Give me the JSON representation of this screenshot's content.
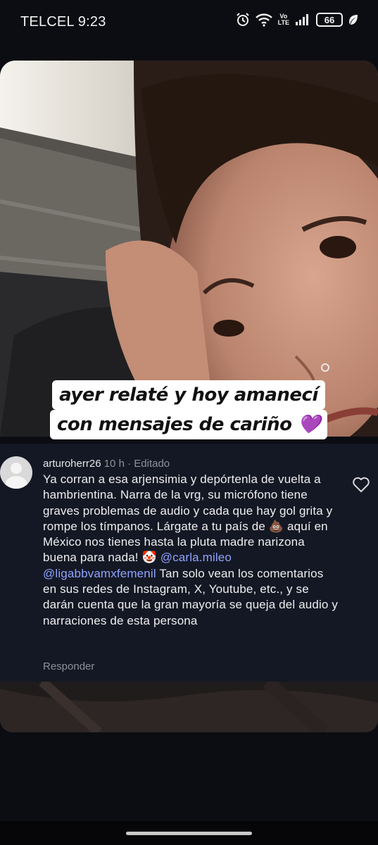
{
  "status_bar": {
    "carrier_time": "TELCEL 9:23",
    "volte_top": "Vo",
    "volte_bottom": "LTE",
    "battery": "66",
    "icons": [
      "alarm-icon",
      "wifi-icon",
      "volte-icon",
      "signal-icon",
      "battery-icon",
      "leaf-icon"
    ]
  },
  "story": {
    "caption_line1": "ayer relaté y hoy amanecí",
    "caption_line2": "con mensajes de cariño 💜"
  },
  "comment": {
    "username": "arturoherr26",
    "time": "10 h",
    "separator": " · ",
    "edited": "Editado",
    "text_part1": "Ya corran a esa arjensimia y depórtenla de vuelta a hambrientina. Narra de la vrg, su micrófono tiene graves problemas de audio y cada que hay gol grita y rompe los tímpanos. Lárgate a tu país de 💩 aquí en México nos tienes hasta la pluta madre narizona buena para nada! 🤡 ",
    "mention1": "@carla.mileo",
    "mention2": "@ligabbvamxfemenil",
    "text_part2": " Tan solo vean los comentarios en sus redes de Instagram, X, Youtube, etc., y se darán cuenta que la gran mayoría se queja del audio y narraciones de esta persona",
    "reply_label": "Responder"
  },
  "colors": {
    "background": "#0b0d12",
    "comment_bg": "#141824",
    "mention": "#8ea3ff",
    "caption_bg": "#ffffff"
  }
}
